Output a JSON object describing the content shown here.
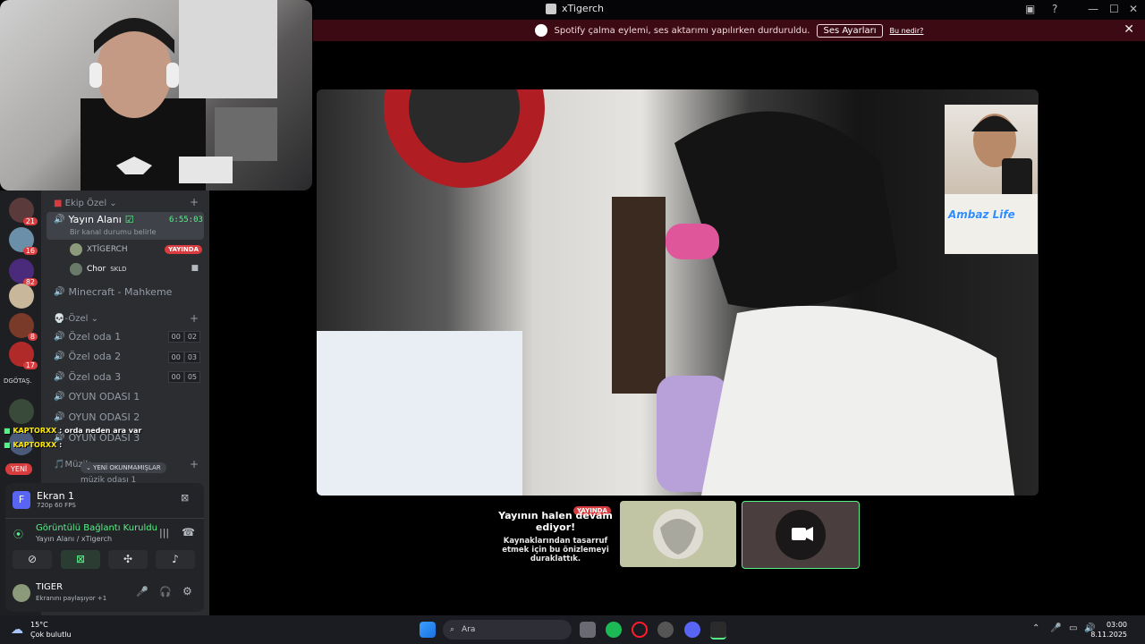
{
  "window": {
    "title": "xTigerch",
    "controls": [
      "—",
      "☐",
      "✕"
    ]
  },
  "spotify_bar": {
    "message": "Spotify çalma eylemi, ses aktarımı yapılırken durduruldu.",
    "settings_button": "Ses Ayarları",
    "what_link": "Bu nedir?"
  },
  "server_rail": {
    "badges": [
      "21",
      "16",
      "82",
      "8",
      "17"
    ],
    "text_server": "DGÖTAŞ.",
    "new_pill": "YENİ"
  },
  "channels": {
    "category_team": "Ekip Özel",
    "active_channel": {
      "name": "Yayın Alanı",
      "timer": "6:55:03",
      "status_placeholder": "Bir kanal durumu belirle"
    },
    "voice_users": [
      {
        "name": "XTİGERCH",
        "badge": "YAYINDA"
      },
      {
        "name": "Chor",
        "tag": "SKLD"
      }
    ],
    "minecraft": "Minecraft - Mahkeme",
    "category_private": "-Özel",
    "private_rooms": [
      {
        "name": "Özel oda 1",
        "count_a": "00",
        "count_b": "02"
      },
      {
        "name": "Özel oda 2",
        "count_a": "00",
        "count_b": "03"
      },
      {
        "name": "Özel oda 3",
        "count_a": "00",
        "count_b": "05"
      }
    ],
    "game_rooms": [
      "OYUN ODASI 1",
      "OYUN ODASI 2",
      "OYUN ODASI 3"
    ],
    "category_music": "Müzik",
    "music_room": "müzik odası 1",
    "unread_pill": "YENİ OKUNMAMIŞLAR"
  },
  "chat_overlay": [
    {
      "name": "KAPTORXX",
      "text": ": orda neden ara var"
    },
    {
      "name": "KAPTORXX",
      "text": ":"
    }
  ],
  "stream_panel": {
    "screen_name": "Ekran 1",
    "screen_quality": "720p 60 FPS",
    "connection_status": "Görüntülü Bağlantı Kuruldu",
    "connection_location": "Yayın Alanı / xTigerch"
  },
  "user_panel": {
    "username": "TIGER",
    "status": "Ekranını paylaşıyor +1"
  },
  "pip": {
    "label": "Ambaz Life"
  },
  "paused_preview": {
    "live_badge": "YAYINDA",
    "title": "Yayının halen devam ediyor!",
    "description": "Kaynaklarından tasarruf etmek için bu önizlemeyi duraklattık."
  },
  "taskbar": {
    "temperature": "15°C",
    "weather": "Çok bulutlu",
    "search_placeholder": "Ara",
    "time": "03:00",
    "date": "8.11.2025"
  },
  "colors": {
    "live_red": "#d83c3e",
    "online_green": "#57f287",
    "spotify_bar_bg": "#3c0a12"
  }
}
